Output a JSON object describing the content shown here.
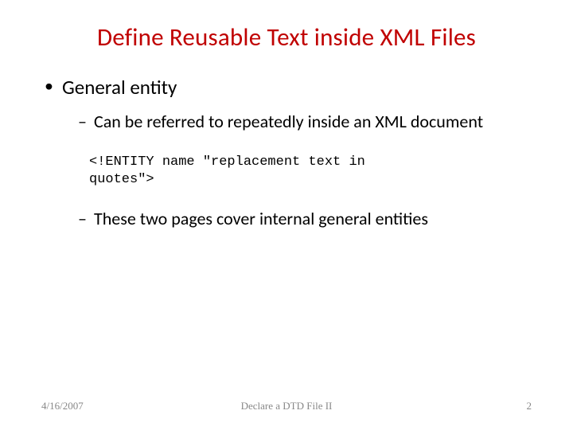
{
  "title": "Define Reusable Text inside XML Files",
  "bullets": {
    "l1": "General entity",
    "l2a": "Can be referred to repeatedly inside an XML document",
    "code": "<!ENTITY name \"replacement text in quotes\">",
    "l2b": "These two pages cover internal general entities"
  },
  "footer": {
    "date": "4/16/2007",
    "center": "Declare a DTD File II",
    "page": "2"
  }
}
